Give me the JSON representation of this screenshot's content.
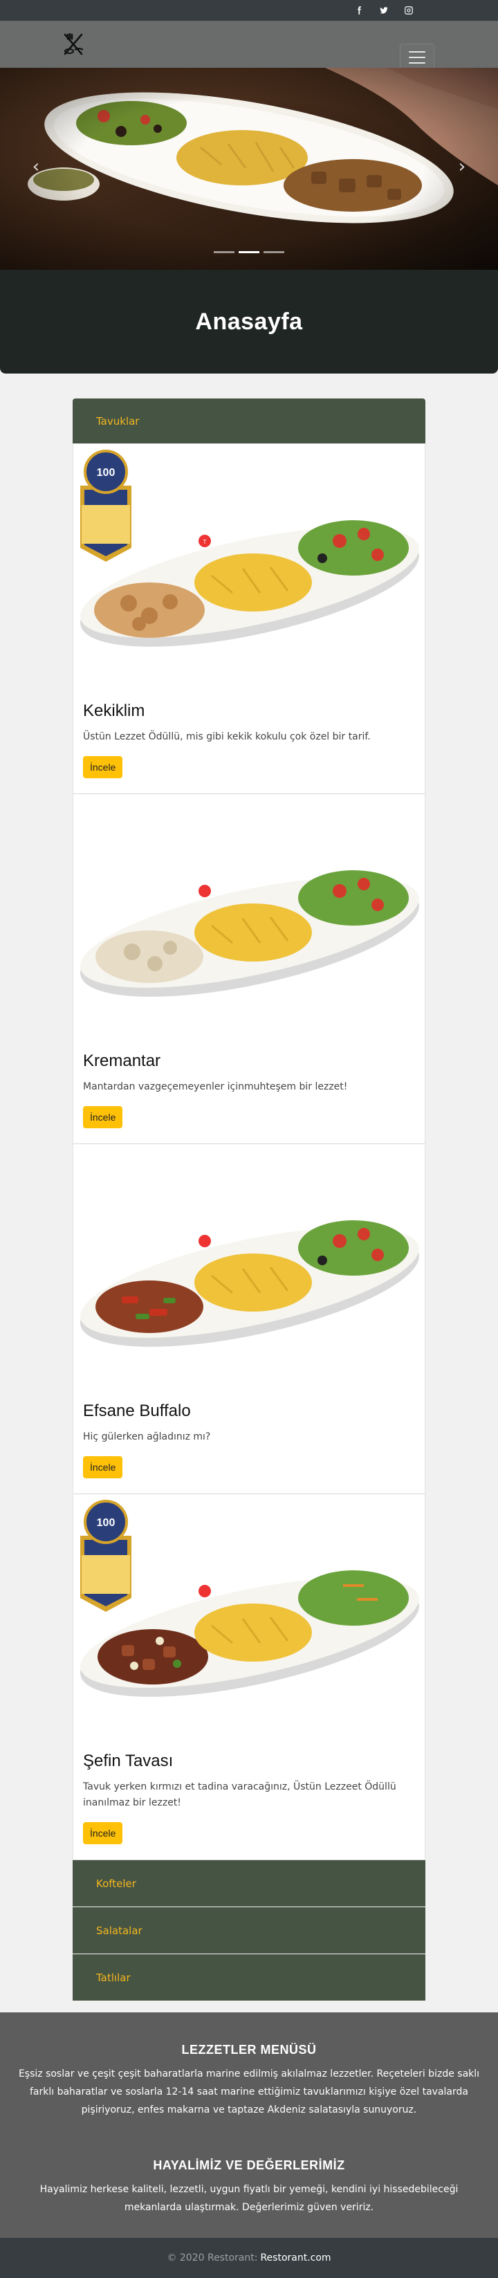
{
  "topbar": {
    "social": [
      {
        "icon": "facebook-icon"
      },
      {
        "icon": "twitter-icon"
      },
      {
        "icon": "instagram-icon"
      }
    ]
  },
  "navbar": {
    "logo_icon": "fork-knife-icon",
    "toggler_icon": "hamburger-icon"
  },
  "hero": {
    "slides": 3,
    "active_slide": 2
  },
  "page_title": "Anasayfa",
  "accordion": {
    "open_section": "Tavuklar",
    "items": [
      {
        "name": "Kekiklim",
        "desc": "Üstün Lezzet Ödüllü, mis gibi kekik kokulu çok özel bir tarif.",
        "button": "İncele",
        "badge": true
      },
      {
        "name": "Kremantar",
        "desc": "Mantardan vazgeçemeyenler içinmuhteşem bir lezzet!",
        "button": "İncele",
        "badge": false
      },
      {
        "name": "Efsane Buffalo",
        "desc": "Hiç gülerken ağladınız mı?",
        "button": "İncele",
        "badge": false
      },
      {
        "name": "Şefin Tavası",
        "desc": "Tavuk yerken kırmızı et tadina varacağınız, Üstün Lezzeet Ödüllü inanılmaz bir lezzet!",
        "button": "İncele",
        "badge": true
      }
    ],
    "closed_sections": [
      "Kofteler",
      "Salatalar",
      "Tatlılar"
    ]
  },
  "footer": {
    "menu_title": "LEZZETLER MENÜSÜ",
    "menu_text": "Eşsiz soslar ve çeşit çeşit baharatlarla marine edilmiş akılalmaz lezzetler. Reçeteleri bizde saklı farklı baharatlar ve soslarla 12-14 saat marine ettiğimiz tavuklarımızı kişiye özel tavalarda pişiriyoruz, enfes makarna ve taptaze Akdeniz salatasıyla sunuyoruz.",
    "values_title": "HAYALİMİZ VE DEĞERLERİMİZ",
    "values_text": "Hayalimiz herkese kaliteli, lezzetli, uygun fiyatlı bir yemeği, kendini iyi hissedebileceği mekanlarda ulaştırmak. Değerlerimiz güven veririz."
  },
  "copyright": {
    "text": "© 2020 Restorant:",
    "link": "Restorant.com"
  },
  "colors": {
    "accent": "#ffc107",
    "accordion": "#465443",
    "header": "#1f2623",
    "link_text": "#f3b71f"
  }
}
